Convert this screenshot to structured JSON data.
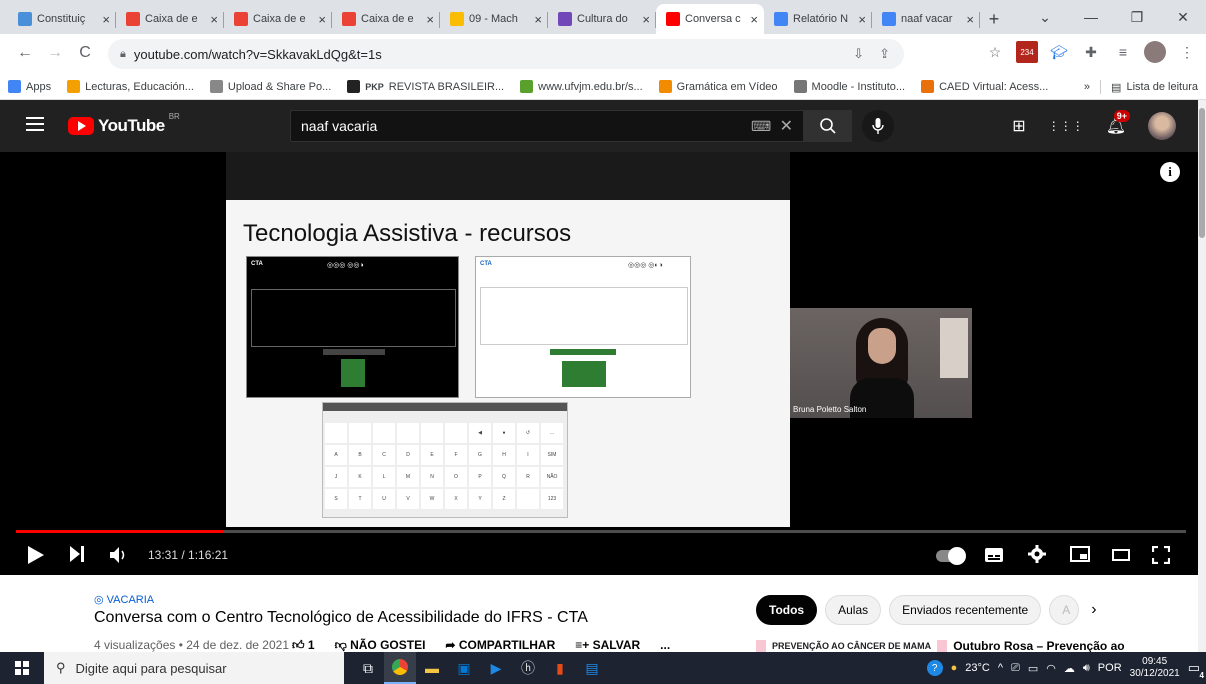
{
  "browser": {
    "tabs": [
      {
        "title": "Constituiç",
        "icon": "document-icon",
        "color": "#4a90d9"
      },
      {
        "title": "Caixa de e",
        "icon": "gmail-icon",
        "color": "#ea4335"
      },
      {
        "title": "Caixa de e",
        "icon": "gmail-icon",
        "color": "#ea4335"
      },
      {
        "title": "Caixa de e",
        "icon": "gmail-icon",
        "color": "#ea4335"
      },
      {
        "title": "09 - Mach",
        "icon": "drive-icon",
        "color": "#fbbc04"
      },
      {
        "title": "Cultura do",
        "icon": "forms-icon",
        "color": "#7248b9"
      },
      {
        "title": "Conversa c",
        "icon": "youtube-icon",
        "color": "#ff0000"
      },
      {
        "title": "Relatório N",
        "icon": "docs-icon",
        "color": "#4285f4"
      },
      {
        "title": "naaf vacar",
        "icon": "google-icon",
        "color": "#4285f4"
      }
    ],
    "active_tab": 6,
    "url": "youtube.com/watch?v=SkkavakLdQg&t=1s",
    "bookmarks": [
      {
        "label": "Apps",
        "color": "#4285f4"
      },
      {
        "label": "Lecturas, Educación...",
        "color": "#f4a000"
      },
      {
        "label": "Upload & Share Po...",
        "color": "#888888"
      },
      {
        "label": "REVISTA BRASILEIR...",
        "color": "#222222",
        "prefix": "PKP"
      },
      {
        "label": "www.ufvjm.edu.br/s...",
        "color": "#5aa02c"
      },
      {
        "label": "Gramática em Vídeo",
        "color": "#f28b00"
      },
      {
        "label": "Moodle - Instituto...",
        "color": "#777777"
      },
      {
        "label": "CAED Virtual: Acess...",
        "color": "#e8710a"
      }
    ],
    "reading_list": "Lista de leitura",
    "more_bookmarks": "»"
  },
  "youtube": {
    "logo_text": "YouTube",
    "country_code": "BR",
    "search_query": "naaf vacaria",
    "notifications_badge": "9+",
    "slide": {
      "title": "Tecnologia Assistiva - recursos",
      "cta_label": "CTA"
    },
    "webcam_name": "Bruna Poletto Salton",
    "time": "13:31 / 1:16:21",
    "progress_fraction": 0.177,
    "hashtag": "VACARIA",
    "title": "Conversa com o Centro Tecnológico de Acessibilidade do IFRS - CTA",
    "stats": "4 visualizações • 24 de dez. de 2021",
    "likes": "1",
    "dislike_label": "NÃO GOSTEI",
    "share_label": "COMPARTILHAR",
    "save_label": "SALVAR",
    "more_label": "...",
    "chips": [
      "Todos",
      "Aulas",
      "Enviados recentemente",
      "A"
    ],
    "rec_thumb_text": "PREVENÇÃO AO CÂNCER DE MAMA",
    "rec_title": "Outubro Rosa – Prevenção ao"
  },
  "taskbar": {
    "search_placeholder": "Digite aqui para pesquisar",
    "weather": "23°C",
    "language": "POR",
    "time": "09:45",
    "date": "30/12/2021",
    "notification_count": "4"
  }
}
